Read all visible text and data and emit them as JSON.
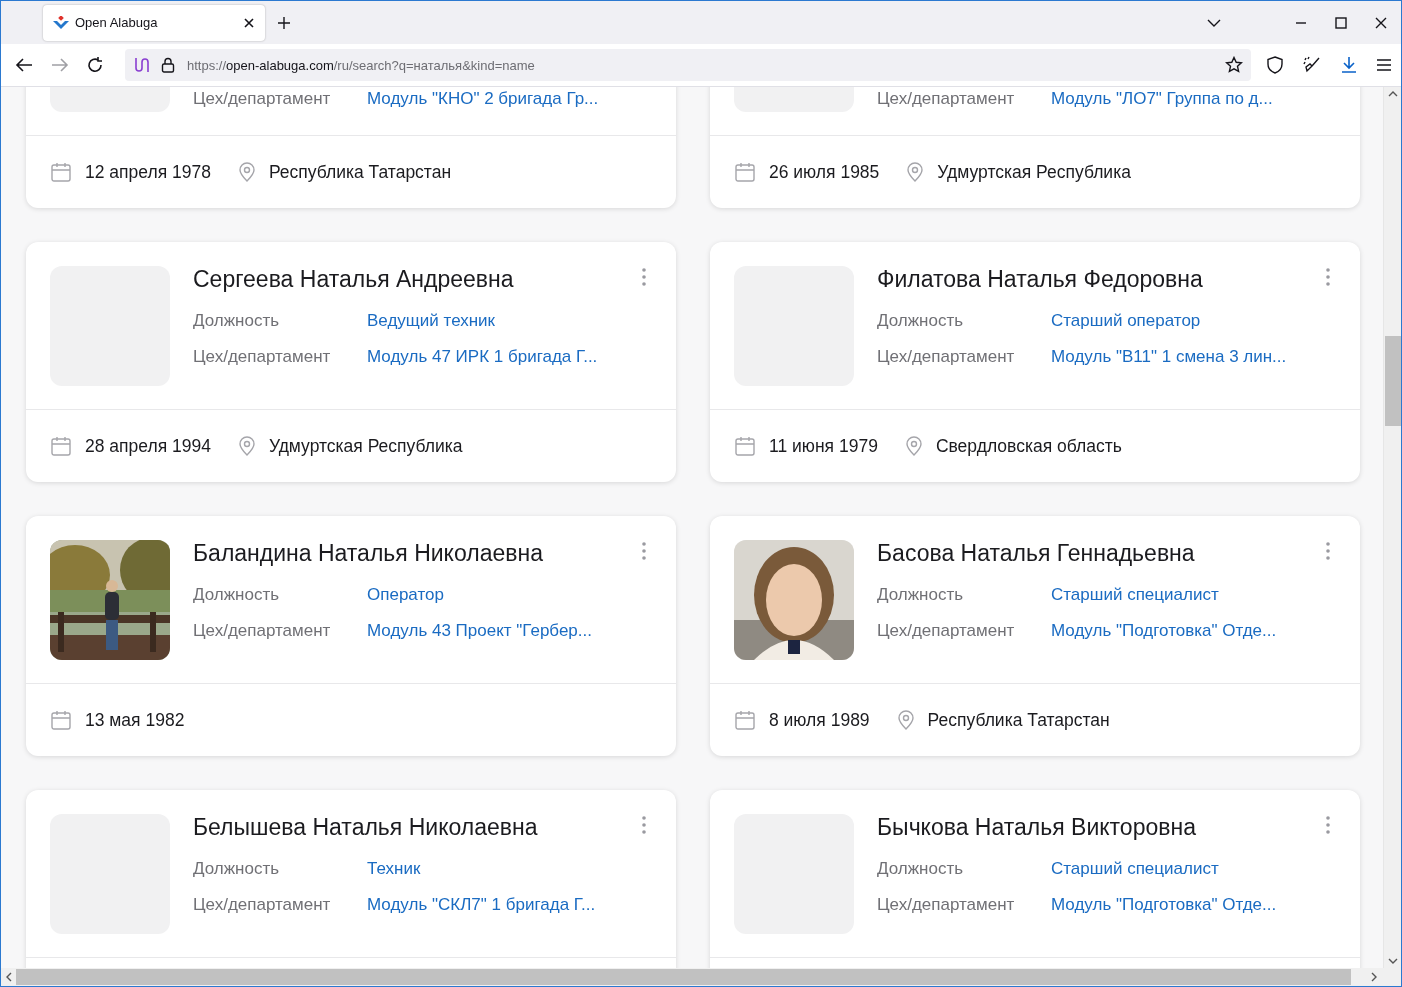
{
  "browser": {
    "tab_title": "Open Alabuga",
    "url_scheme": "https://",
    "url_host": "open-alabuga.com",
    "url_path": "/ru/search?q=наталья&kind=name"
  },
  "cards": [
    {
      "department_label": "Цех/департамент",
      "department": "Модуль \"КНО\" 2 бригада Гр...",
      "birth_date": "12 апреля 1978",
      "location": "Республика Татарстан"
    },
    {
      "department_label": "Цех/департамент",
      "department": "Модуль \"ЛО7\" Группа по д...",
      "birth_date": "26 июля 1985",
      "location": "Удмуртская Республика"
    },
    {
      "name": "Сергеева Наталья Андреевна",
      "position_label": "Должность",
      "position": "Ведущий техник",
      "department_label": "Цех/департамент",
      "department": "Модуль 47 ИРК 1 бригада Г...",
      "birth_date": "28 апреля 1994",
      "location": "Удмуртская Республика"
    },
    {
      "name": "Филатова Наталья Федоровна",
      "position_label": "Должность",
      "position": "Старший оператор",
      "department_label": "Цех/департамент",
      "department": "Модуль \"B11\" 1 смена 3 лин...",
      "birth_date": "11 июня 1979",
      "location": "Свердловская область"
    },
    {
      "name": "Баландина Наталья Николаевна",
      "position_label": "Должность",
      "position": "Оператор",
      "department_label": "Цех/департамент",
      "department": "Модуль 43 Проект \"Гербер...",
      "birth_date": "13 мая 1982"
    },
    {
      "name": "Басова Наталья Геннадьевна",
      "position_label": "Должность",
      "position": "Старший специалист",
      "department_label": "Цех/департамент",
      "department": "Модуль \"Подготовка\" Отде...",
      "birth_date": "8 июля 1989",
      "location": "Республика Татарстан"
    },
    {
      "name": "Белышева Наталья Николаевна",
      "position_label": "Должность",
      "position": "Техник",
      "department_label": "Цех/департамент",
      "department": "Модуль \"СКЛ7\" 1 бригада Г..."
    },
    {
      "name": "Бычкова Наталья Викторовна",
      "position_label": "Должность",
      "position": "Старший специалист",
      "department_label": "Цех/департамент",
      "department": "Модуль \"Подготовка\" Отде..."
    }
  ]
}
